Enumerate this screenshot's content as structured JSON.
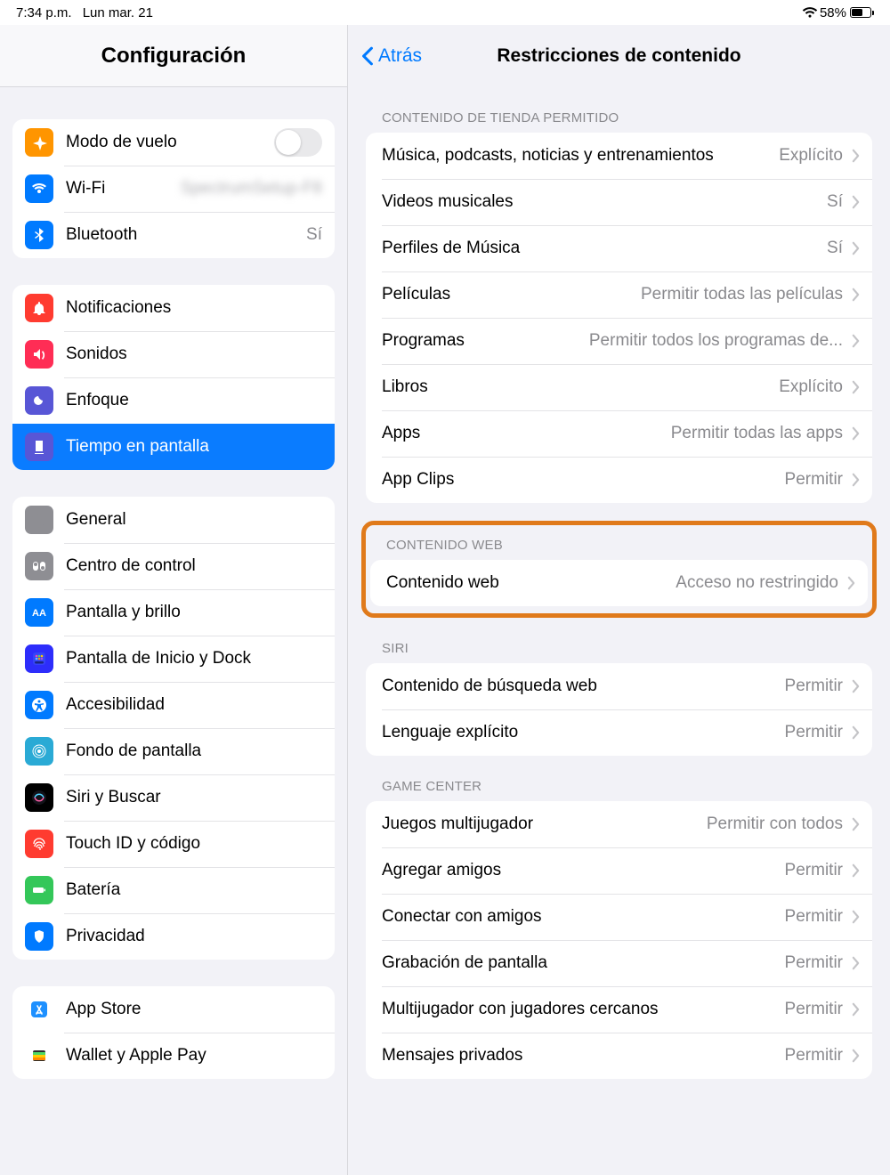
{
  "status": {
    "time": "7:34 p.m.",
    "date": "Lun mar. 21",
    "battery_pct": "58%"
  },
  "sidebar": {
    "title": "Configuración",
    "groups": [
      {
        "key": "net",
        "rows": [
          {
            "key": "airplane",
            "label": "Modo de vuelo",
            "value": "",
            "toggle": true
          },
          {
            "key": "wifi",
            "label": "Wi-Fi",
            "value": "SpectrumSetup-F8",
            "blur": true
          },
          {
            "key": "bt",
            "label": "Bluetooth",
            "value": "Sí"
          }
        ]
      },
      {
        "key": "notif",
        "rows": [
          {
            "key": "notif",
            "label": "Notificaciones"
          },
          {
            "key": "sound",
            "label": "Sonidos"
          },
          {
            "key": "focus",
            "label": "Enfoque"
          },
          {
            "key": "screentime",
            "label": "Tiempo en pantalla",
            "selected": true
          }
        ]
      },
      {
        "key": "general",
        "rows": [
          {
            "key": "gen",
            "label": "General"
          },
          {
            "key": "cc",
            "label": "Centro de control"
          },
          {
            "key": "display",
            "label": "Pantalla y brillo"
          },
          {
            "key": "home",
            "label": "Pantalla de Inicio y Dock"
          },
          {
            "key": "acc",
            "label": "Accesibilidad"
          },
          {
            "key": "wall",
            "label": "Fondo de pantalla"
          },
          {
            "key": "siri",
            "label": "Siri y Buscar"
          },
          {
            "key": "touchid",
            "label": "Touch ID y código"
          },
          {
            "key": "bat",
            "label": "Batería"
          },
          {
            "key": "priv",
            "label": "Privacidad"
          }
        ]
      },
      {
        "key": "store",
        "rows": [
          {
            "key": "appstore",
            "label": "App Store"
          },
          {
            "key": "wallet",
            "label": "Wallet y Apple Pay"
          }
        ]
      }
    ]
  },
  "detail": {
    "back_label": "Atrás",
    "title": "Restricciones de contenido",
    "sections": [
      {
        "key": "store",
        "header": "CONTENIDO DE TIENDA PERMITIDO",
        "rows": [
          {
            "label": "Música, podcasts, noticias y entrenamientos",
            "value": "Explícito"
          },
          {
            "label": "Videos musicales",
            "value": "Sí"
          },
          {
            "label": "Perfiles de Música",
            "value": "Sí"
          },
          {
            "label": "Películas",
            "value": "Permitir todas las películas"
          },
          {
            "label": "Programas",
            "value": "Permitir todos los programas de..."
          },
          {
            "label": "Libros",
            "value": "Explícito"
          },
          {
            "label": "Apps",
            "value": "Permitir todas las apps"
          },
          {
            "label": "App Clips",
            "value": "Permitir"
          }
        ]
      },
      {
        "key": "web",
        "header": "CONTENIDO WEB",
        "highlight": true,
        "rows": [
          {
            "label": "Contenido web",
            "value": "Acceso no restringido"
          }
        ]
      },
      {
        "key": "siri",
        "header": "SIRI",
        "rows": [
          {
            "label": "Contenido de búsqueda web",
            "value": "Permitir"
          },
          {
            "label": "Lenguaje explícito",
            "value": "Permitir"
          }
        ]
      },
      {
        "key": "gc",
        "header": "GAME CENTER",
        "rows": [
          {
            "label": "Juegos multijugador",
            "value": "Permitir con todos"
          },
          {
            "label": "Agregar amigos",
            "value": "Permitir"
          },
          {
            "label": "Conectar con amigos",
            "value": "Permitir"
          },
          {
            "label": "Grabación de pantalla",
            "value": "Permitir"
          },
          {
            "label": "Multijugador con jugadores cercanos",
            "value": "Permitir"
          },
          {
            "label": "Mensajes privados",
            "value": "Permitir"
          }
        ]
      }
    ]
  }
}
